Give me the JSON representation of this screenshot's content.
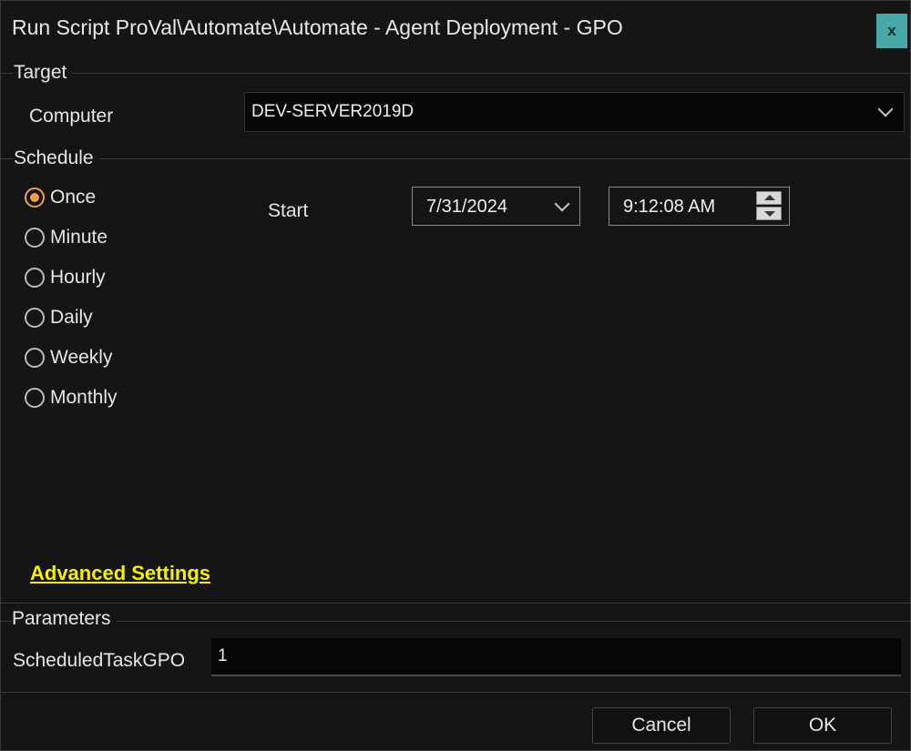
{
  "window": {
    "title": "Run Script ProVal\\Automate\\Automate - Agent Deployment - GPO",
    "close_label": "x"
  },
  "target": {
    "section_label": "Target",
    "computer_label": "Computer",
    "computer_value": "DEV-SERVER2019D"
  },
  "schedule": {
    "section_label": "Schedule",
    "options": [
      {
        "label": "Once",
        "checked": true
      },
      {
        "label": "Minute",
        "checked": false
      },
      {
        "label": "Hourly",
        "checked": false
      },
      {
        "label": "Daily",
        "checked": false
      },
      {
        "label": "Weekly",
        "checked": false
      },
      {
        "label": "Monthly",
        "checked": false
      }
    ],
    "start_label": "Start",
    "start_date": "7/31/2024",
    "start_time": "9:12:08 AM"
  },
  "advanced_settings_label": "Advanced Settings",
  "parameters": {
    "section_label": "Parameters",
    "param_label": "ScheduledTaskGPO",
    "param_value": "1"
  },
  "buttons": {
    "cancel": "Cancel",
    "ok": "OK"
  },
  "colors": {
    "accent_radio": "#f0a04b",
    "link": "#f5f000",
    "close_bg": "#47a8a8",
    "background": "#151515"
  }
}
